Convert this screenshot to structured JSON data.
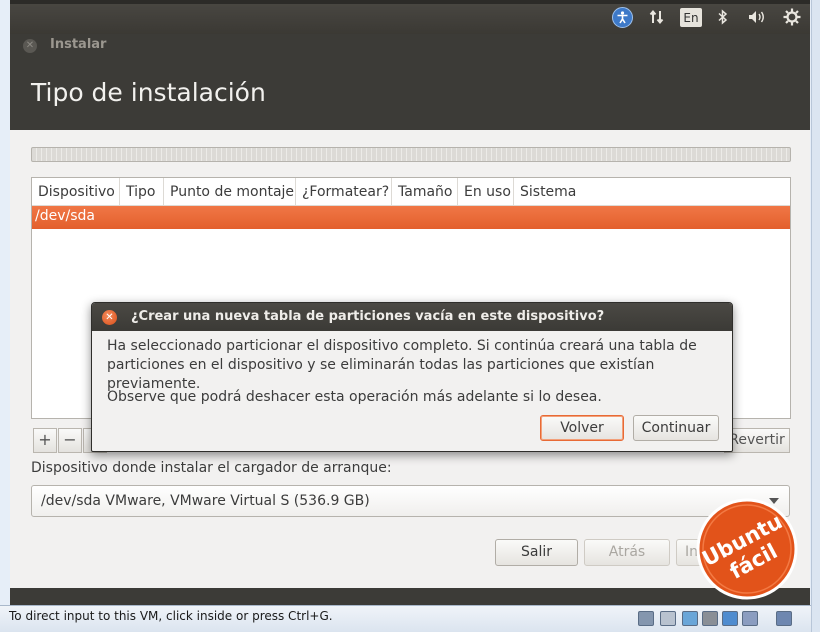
{
  "topbar": {
    "icons": [
      "accessibility-icon",
      "network-transfer-icon",
      "keyboard-layout-icon",
      "bluetooth-icon",
      "volume-icon",
      "settings-gear-icon"
    ],
    "keyboard_layout": "En"
  },
  "window": {
    "title": "Instalar",
    "heading": "Tipo de instalación"
  },
  "partition_table": {
    "columns": [
      "Dispositivo",
      "Tipo",
      "Punto de montaje",
      "¿Formatear?",
      "Tamaño",
      "En uso",
      "Sistema"
    ],
    "rows": [
      {
        "device": "/dev/sda",
        "selected": true
      }
    ]
  },
  "toolbar": {
    "add_label": "+",
    "remove_label": "−",
    "revert_label": "Revertir"
  },
  "bootloader": {
    "label": "Dispositivo donde instalar el cargador de arranque:",
    "selected": "/dev/sda  VMware, VMware Virtual S (536.9 GB)"
  },
  "nav": {
    "quit_label": "Salir",
    "back_label": "Atrás",
    "install_label": "In"
  },
  "dialog": {
    "title": "¿Crear una nueva tabla de particiones vacía en este dispositivo?",
    "line1": "Ha seleccionado particionar el dispositivo completo. Si continúa creará una tabla de",
    "line2": "particiones en el dispositivo y se eliminarán todas las particiones que existían previamente.",
    "line3": "Observe que podrá deshacer esta operación más adelante si lo desea.",
    "back_label": "Volver",
    "continue_label": "Continuar"
  },
  "statusbar": {
    "text": "To direct input to this VM, click inside or press Ctrl+G."
  },
  "watermark": {
    "line1": "Ubuntu",
    "line2": "fácil"
  },
  "colors": {
    "accent": "#e35f2c",
    "titlebar": "#3c3b37",
    "background": "#f2f1f0"
  }
}
